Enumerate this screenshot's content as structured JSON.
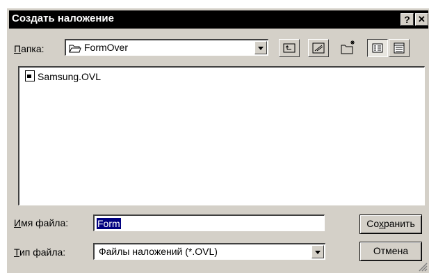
{
  "window": {
    "title": "Создать наложение",
    "help_btn": "?",
    "close_btn": "✕"
  },
  "folder": {
    "label": "Папка:",
    "value": "FormOver"
  },
  "toolbar": {
    "icons": [
      "up-folder-icon",
      "desktop-icon",
      "new-folder-icon",
      "list-view-icon",
      "details-view-icon"
    ]
  },
  "files": [
    {
      "name": "Samsung.OVL"
    }
  ],
  "filename": {
    "label": "Имя файла:",
    "value": "Form"
  },
  "filetype": {
    "label": "Тип файла:",
    "value": "Файлы наложений (*.OVL)"
  },
  "buttons": {
    "save": "Сохранить",
    "cancel": "Отмена"
  }
}
